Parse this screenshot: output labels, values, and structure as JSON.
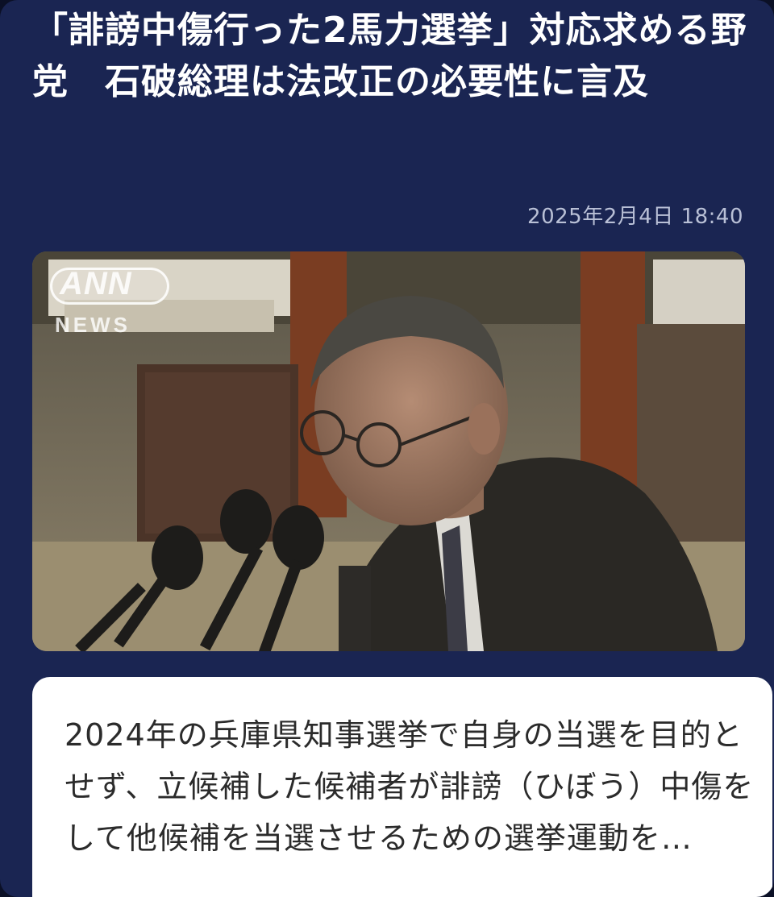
{
  "article": {
    "headline": "「誹謗中傷行った2馬力選挙」対応求める野党　石破総理は法改正の必要性に言及",
    "date": "2025年2月4日 18:40",
    "summary": "2024年の兵庫県知事選挙で自身の当選を目的とせず、立候補した候補者が誹謗（ひぼう）中傷をして他候補を当選させるための選挙運動を…"
  },
  "image": {
    "logo_text": "ANN",
    "logo_subtext": "NEWS"
  },
  "colors": {
    "card_background": "#1a2552",
    "headline_text": "#ffffff",
    "date_text": "#b9c0d6",
    "summary_background": "#ffffff",
    "summary_text": "#2b2b2b"
  }
}
